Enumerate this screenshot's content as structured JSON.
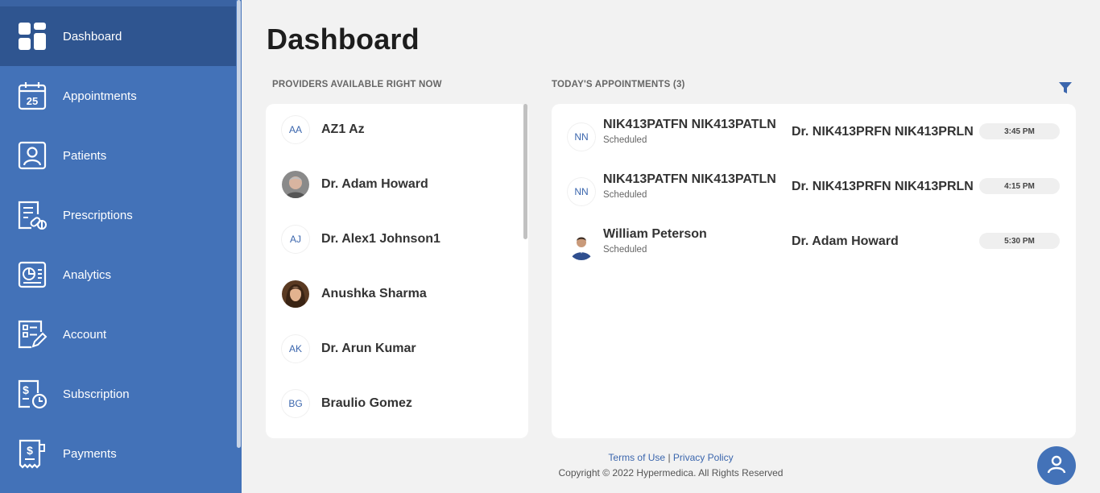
{
  "sidebar": {
    "items": [
      {
        "label": "Dashboard",
        "icon": "dashboard-icon",
        "active": true
      },
      {
        "label": "Appointments",
        "icon": "calendar-icon",
        "calendar_day": "25"
      },
      {
        "label": "Patients",
        "icon": "patient-icon"
      },
      {
        "label": "Prescriptions",
        "icon": "prescription-icon"
      },
      {
        "label": "Analytics",
        "icon": "analytics-icon"
      },
      {
        "label": "Account",
        "icon": "account-icon"
      },
      {
        "label": "Subscription",
        "icon": "subscription-icon"
      },
      {
        "label": "Payments",
        "icon": "payments-icon"
      }
    ]
  },
  "main": {
    "title": "Dashboard",
    "providers_section": {
      "title": "PROVIDERS AVAILABLE RIGHT NOW",
      "providers": [
        {
          "initials": "AA",
          "name": "AZ1 Az",
          "has_photo": false
        },
        {
          "initials": "",
          "name": "Dr. Adam Howard",
          "has_photo": true
        },
        {
          "initials": "AJ",
          "name": "Dr. Alex1 Johnson1",
          "has_photo": false
        },
        {
          "initials": "",
          "name": "Anushka Sharma",
          "has_photo": true
        },
        {
          "initials": "AK",
          "name": "Dr. Arun Kumar",
          "has_photo": false
        },
        {
          "initials": "BG",
          "name": "Braulio Gomez",
          "has_photo": false
        }
      ]
    },
    "appointments_section": {
      "title": "TODAY'S APPOINTMENTS (3)",
      "appointments": [
        {
          "initials": "NN",
          "patient": "NIK413PATFN NIK413PATLN",
          "status": "Scheduled",
          "provider": "Dr. NIK413PRFN NIK413PRLN",
          "time": "3:45 PM"
        },
        {
          "initials": "NN",
          "patient": "NIK413PATFN NIK413PATLN",
          "status": "Scheduled",
          "provider": "Dr. NIK413PRFN NIK413PRLN",
          "time": "4:15 PM"
        },
        {
          "initials": "",
          "patient": "William Peterson",
          "status": "Scheduled",
          "provider": "Dr. Adam Howard",
          "time": "5:30 PM"
        }
      ]
    }
  },
  "footer": {
    "terms": "Terms of Use",
    "separator": "|",
    "privacy": "Privacy Policy",
    "copyright": "Copyright © 2022 Hypermedica. All Rights Reserved"
  },
  "colors": {
    "sidebar": "#4372b8",
    "sidebar_active": "#2f5590",
    "accent": "#3b66ad"
  }
}
